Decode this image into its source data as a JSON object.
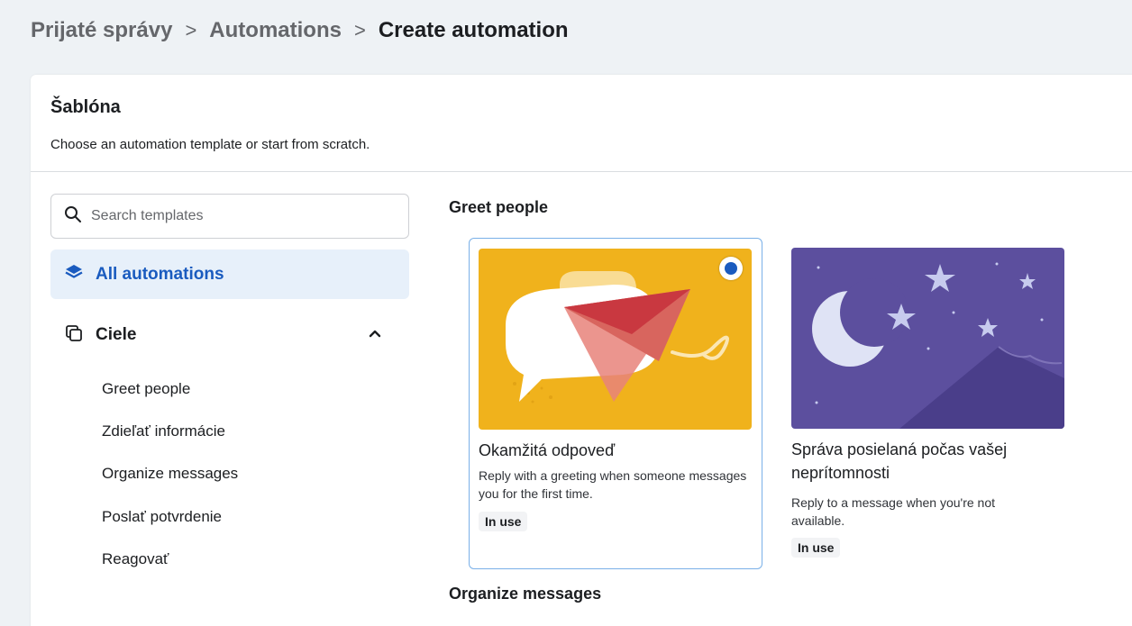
{
  "breadcrumb": {
    "items": [
      "Prijaté správy",
      "Automations"
    ],
    "separator": ">",
    "current": "Create automation"
  },
  "section": {
    "title": "Šablóna",
    "subtitle": "Choose an automation template or start from scratch."
  },
  "search": {
    "placeholder": "Search templates",
    "value": ""
  },
  "sidebar": {
    "all_label": "All automations",
    "group_label": "Ciele",
    "group_items": [
      "Greet people",
      "Zdieľať informácie",
      "Organize messages",
      "Poslať potvrdenie",
      "Reagovať"
    ]
  },
  "groups": [
    {
      "heading": "Greet people",
      "templates": [
        {
          "name": "Okamžitá odpoveď",
          "description": "Reply with a greeting when someone messages you for the first time.",
          "badge": "In use",
          "selected": true
        },
        {
          "name": "Správa posielaná počas vašej neprítomnosti",
          "description": "Reply to a message when you're not available.",
          "badge": "In use",
          "selected": false
        }
      ]
    },
    {
      "heading": "Organize messages"
    }
  ],
  "colors": {
    "accent": "#1a5bbf",
    "selected_nav_bg": "#e7f0fa",
    "thumb_yellow": "#f0b21c",
    "thumb_purple": "#5c4f9e"
  },
  "icons": {
    "search": "search-icon",
    "all_automations": "layers-icon",
    "goals": "cards-icon",
    "collapse": "chevron-up-icon"
  }
}
